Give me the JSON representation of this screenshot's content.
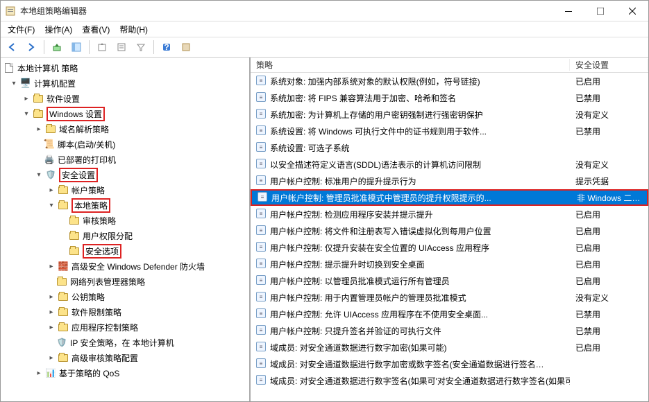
{
  "window": {
    "title": "本地组策略编辑器"
  },
  "menu": {
    "file": "文件(F)",
    "action": "操作(A)",
    "view": "查看(V)",
    "help": "帮助(H)"
  },
  "tree": {
    "root": "本地计算机 策略",
    "computer_config": "计算机配置",
    "software_settings": "软件设置",
    "windows_settings": "Windows 设置",
    "name_res": "域名解析策略",
    "scripts": "脚本(启动/关机)",
    "deployed_printers": "已部署的打印机",
    "security_settings": "安全设置",
    "account_policies": "帐户策略",
    "local_policies": "本地策略",
    "audit_policy": "审核策略",
    "user_rights": "用户权限分配",
    "security_options": "安全选项",
    "defender": "高级安全 Windows Defender 防火墙",
    "netlist": "网络列表管理器策略",
    "pubkey": "公钥策略",
    "software_restrict": "软件限制策略",
    "app_control": "应用程序控制策略",
    "ipsec": "IP 安全策略，在 本地计算机",
    "adv_audit": "高级审核策略配置",
    "qos": "基于策略的 QoS"
  },
  "list": {
    "header_policy": "策略",
    "header_setting": "安全设置",
    "rows": [
      {
        "p": "系统对象: 加强内部系统对象的默认权限(例如，符号链接)",
        "s": "已启用"
      },
      {
        "p": "系统加密: 将 FIPS 兼容算法用于加密、哈希和签名",
        "s": "已禁用"
      },
      {
        "p": "系统加密: 为计算机上存储的用户密钥强制进行强密钥保护",
        "s": "没有定义"
      },
      {
        "p": "系统设置: 将 Windows 可执行文件中的证书规则用于软件...",
        "s": "已禁用"
      },
      {
        "p": "系统设置: 可选子系统",
        "s": ""
      },
      {
        "p": "以安全描述符定义语言(SDDL)语法表示的计算机访问限制",
        "s": "没有定义"
      },
      {
        "p": "用户帐户控制: 标准用户的提升提示行为",
        "s": "提示凭据"
      },
      {
        "p": "用户帐户控制: 管理员批准模式中管理员的提升权限提示的...",
        "s": "非 Windows 二进制文...",
        "sel": true
      },
      {
        "p": "用户帐户控制: 检测应用程序安装并提示提升",
        "s": "已启用"
      },
      {
        "p": "用户帐户控制: 将文件和注册表写入错误虚拟化到每用户位置",
        "s": "已启用"
      },
      {
        "p": "用户帐户控制: 仅提升安装在安全位置的 UIAccess 应用程序",
        "s": "已启用"
      },
      {
        "p": "用户帐户控制: 提示提升时切换到安全桌面",
        "s": "已启用"
      },
      {
        "p": "用户帐户控制: 以管理员批准模式运行所有管理员",
        "s": "已启用"
      },
      {
        "p": "用户帐户控制: 用于内置管理员帐户的管理员批准模式",
        "s": "没有定义"
      },
      {
        "p": "用户帐户控制: 允许 UIAccess 应用程序在不使用安全桌面...",
        "s": "已禁用"
      },
      {
        "p": "用户帐户控制: 只提升签名并验证的可执行文件",
        "s": "已禁用"
      },
      {
        "p": "域成员: 对安全通道数据进行数字加密(如果可能)",
        "s": "已启用"
      },
      {
        "p": "域成员: 对安全通道数据进行数字加密或数字签名(安全通道数据进行签名…",
        "s": ""
      },
      {
        "p": "域成员: 对安全通道数据进行数字签名(如果可'对安全通道数据进行数字签名(如果可'对安全通…",
        "s": ""
      }
    ]
  }
}
